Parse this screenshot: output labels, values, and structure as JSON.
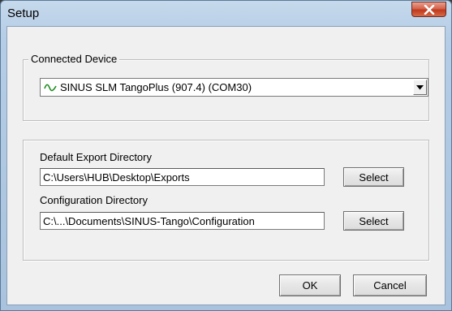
{
  "window": {
    "title": "Setup"
  },
  "connected_device": {
    "group_label": "Connected Device",
    "selected_device": "SINUS SLM TangoPlus (907.4) (COM30)"
  },
  "directories": {
    "export_label": "Default Export Directory",
    "export_value": "C:\\Users\\HUB\\Desktop\\Exports",
    "export_select": "Select",
    "config_label": "Configuration Directory",
    "config_value": "C:\\...\\Documents\\SINUS-Tango\\Configuration",
    "config_select": "Select"
  },
  "footer": {
    "ok_label": "OK",
    "cancel_label": "Cancel"
  },
  "icons": {
    "close": "close-icon",
    "device": "waveform-icon",
    "dropdown": "dropdown-arrow-icon"
  }
}
